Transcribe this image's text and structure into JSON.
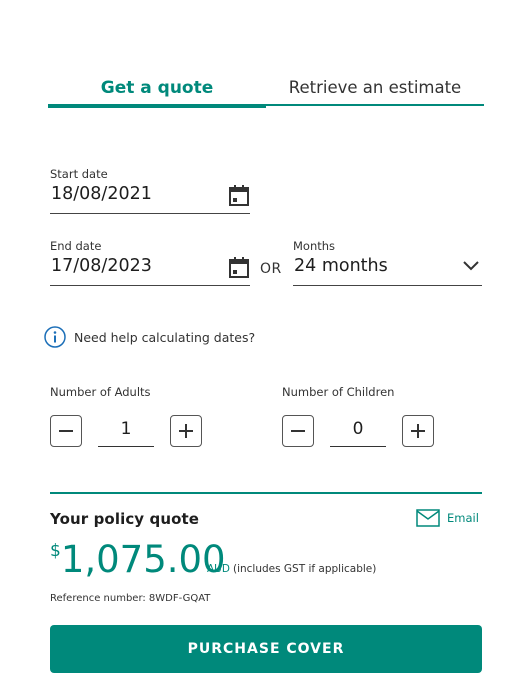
{
  "tabs": {
    "active": "Get a quote",
    "inactive": "Retrieve an estimate"
  },
  "start_date": {
    "label": "Start date",
    "value": "18/08/2021",
    "icon": "calendar-icon"
  },
  "end_date": {
    "label": "End date",
    "value": "17/08/2023",
    "icon": "calendar-icon"
  },
  "or_text": "OR",
  "months": {
    "label": "Months",
    "value": "24 months",
    "icon": "chevron-down-icon"
  },
  "help": {
    "text": "Need help calculating dates?",
    "icon": "info-icon"
  },
  "adults": {
    "label": "Number of Adults",
    "value": "1"
  },
  "children": {
    "label": "Number of Children",
    "value": "0"
  },
  "quote": {
    "title": "Your policy quote",
    "email_label": "Email",
    "currency_symbol": "$",
    "amount": "1,075.00",
    "currency_code": "AUD",
    "gst_note": "(includes GST if applicable)",
    "reference": "Reference number: 8WDF-GQAT"
  },
  "purchase_button": "PURCHASE COVER",
  "colors": {
    "accent": "#00897b",
    "text": "#1e1e1e"
  }
}
